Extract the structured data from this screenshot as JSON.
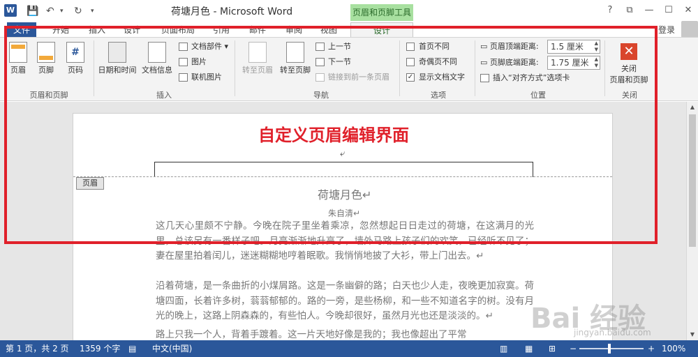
{
  "titlebar": {
    "app_icon": "W",
    "title": "荷塘月色 - Microsoft Word",
    "context_tab_group": "页眉和页脚工具",
    "buttons": [
      "?",
      "⧉",
      "—",
      "☐",
      "✕"
    ]
  },
  "tabs": [
    "文件",
    "开始",
    "插入",
    "设计",
    "页面布局",
    "引用",
    "邮件",
    "审阅",
    "视图",
    "设计"
  ],
  "login": "登录",
  "ribbon": {
    "groups": {
      "header_footer": {
        "label": "页眉和页脚",
        "header": "页眉",
        "footer": "页脚",
        "page_number": "页码"
      },
      "insert": {
        "label": "插入",
        "datetime": "日期和时间",
        "docinfo": "文档信息",
        "doc_parts": "文档部件",
        "picture": "图片",
        "online_picture": "联机图片"
      },
      "nav": {
        "label": "导航",
        "goto_header": "转至页眉",
        "goto_footer": "转至页脚",
        "prev": "上一节",
        "next": "下一节",
        "link_prev": "链接到前一条页眉"
      },
      "options": {
        "label": "选项",
        "first_page": "首页不同",
        "odd_even": "奇偶页不同",
        "show_text": "显示文档文字"
      },
      "position": {
        "label": "位置",
        "header_top": "页眉顶端距离:",
        "header_top_value": "1.5 厘米",
        "footer_bottom": "页脚底端距离:",
        "footer_bottom_value": "1.75 厘米",
        "insert_align_tab": "插入“对齐方式”选项卡"
      },
      "close": {
        "label": "关闭",
        "close_btn_line1": "关闭",
        "close_btn_line2": "页眉和页脚"
      }
    }
  },
  "document": {
    "annotation": "自定义页眉编辑界面",
    "header_tag": "页眉",
    "title": "荷塘月色↵",
    "author": "朱自清↵",
    "paragraphs": [
      "    这几天心里颇不宁静。今晚在院子里坐着乘凉，忽然想起日日走过的荷塘，在这满月的光里，总该另有一番样子吧。月亮渐渐地升高了，墙外马路上孩子们的欢笑，已经听不见了；妻在屋里拍着闰儿，迷迷糊糊地哼着眠歌。我悄悄地披了大衫，带上门出去。↵",
      "    沿着荷塘，是一条曲折的小煤屑路。这是一条幽僻的路；白天也少人走，夜晚更加寂寞。荷塘四面，长着许多树，蓊蓊郁郁的。路的一旁，是些杨柳，和一些不知道名字的树。没有月光的晚上，这路上阴森森的，有些怕人。今晚却很好，虽然月光也还是淡淡的。↵",
      "    路上只我一个人，背着手踱着。这一片天地好像是我的；我也像超出了平常"
    ]
  },
  "watermark": "Bai 经验",
  "watermark_sub": "jingyan.baidu.com",
  "statusbar": {
    "page": "第 1 页，共 2 页",
    "words": "1359 个字",
    "language": "中文(中国)",
    "zoom": "100%",
    "minus": "−",
    "plus": "+"
  }
}
